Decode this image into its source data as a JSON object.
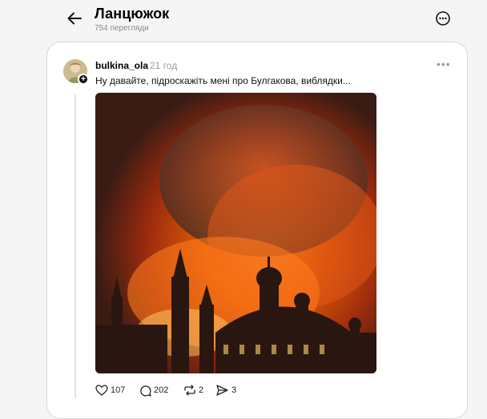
{
  "header": {
    "title": "Ланцюжок",
    "views": "754 перегляди"
  },
  "post": {
    "username": "bulkina_ola",
    "time": "21 год",
    "text": "Ну давайте, підроскажіть мені про Булгакова, виблядки...",
    "image_alt_icon": "image",
    "actions": {
      "likes": "107",
      "comments": "202",
      "reposts": "2",
      "shares": "3"
    }
  },
  "colors": {
    "background": "#f5f5f5",
    "card": "#ffffff",
    "muted": "#9a9a9a",
    "fire": "#ff6a00"
  }
}
